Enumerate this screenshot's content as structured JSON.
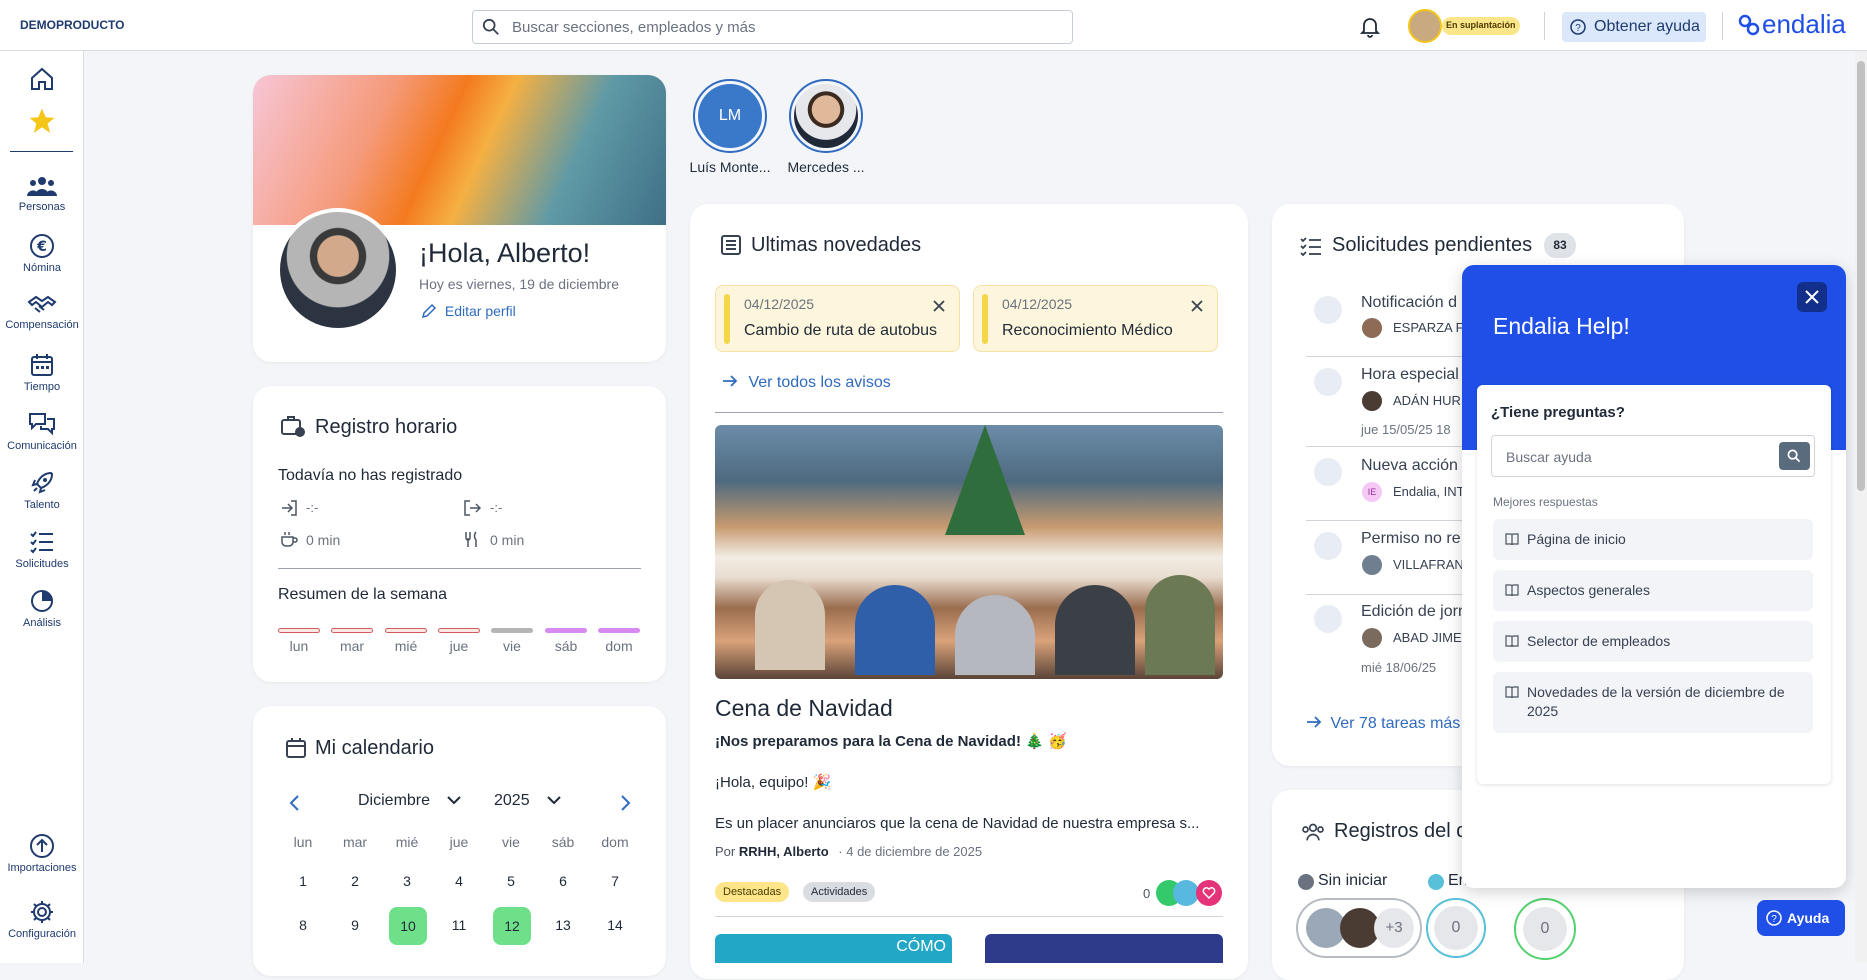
{
  "topbar": {
    "company": "DEMOPRODUCTO",
    "search_placeholder": "Buscar secciones, empleados y más",
    "impersonation": "En suplantación",
    "help_button": "Obtener ayuda",
    "brand": "endalia"
  },
  "sidebar": {
    "items": [
      {
        "label": "Personas",
        "icon": "people-icon"
      },
      {
        "label": "Nómina",
        "icon": "euro-icon"
      },
      {
        "label": "Compensación",
        "icon": "handshake-icon"
      },
      {
        "label": "Tiempo",
        "icon": "calendar-icon"
      },
      {
        "label": "Comunicación",
        "icon": "chat-icon"
      },
      {
        "label": "Talento",
        "icon": "rocket-icon"
      },
      {
        "label": "Solicitudes",
        "icon": "checklist-icon"
      },
      {
        "label": "Análisis",
        "icon": "pie-icon"
      }
    ],
    "bottom": [
      {
        "label": "Importaciones",
        "icon": "upload-icon"
      },
      {
        "label": "Configuración",
        "icon": "gear-icon"
      }
    ]
  },
  "profile": {
    "greeting": "¡Hola, Alberto!",
    "date": "Hoy es viernes, 19 de diciembre",
    "edit": "Editar perfil"
  },
  "time_record": {
    "title": "Registro horario",
    "status": "Todavía no has registrado",
    "in": "-:-",
    "out": "-:-",
    "break": "0 min",
    "meal": "0 min",
    "summary": "Resumen de la semana",
    "days": [
      "lun",
      "mar",
      "mié",
      "jue",
      "vie",
      "sáb",
      "dom"
    ]
  },
  "calendar": {
    "title": "Mi calendario",
    "month": "Diciembre",
    "year": "2025",
    "weekdays": [
      "lun",
      "mar",
      "mié",
      "jue",
      "vie",
      "sáb",
      "dom"
    ],
    "row1": [
      "1",
      "2",
      "3",
      "4",
      "5",
      "6",
      "7"
    ],
    "row2": [
      "8",
      "9",
      "10",
      "11",
      "12",
      "13",
      "14"
    ],
    "highlight": [
      "10",
      "12"
    ]
  },
  "shortcuts": [
    {
      "initials": "LM",
      "name": "Luís Monte..."
    },
    {
      "name": "Mercedes ..."
    }
  ],
  "news": {
    "title": "Ultimas novedades",
    "notices": [
      {
        "date": "04/12/2025",
        "text": "Cambio de ruta de autobus"
      },
      {
        "date": "04/12/2025",
        "text": "Reconocimiento Médico"
      }
    ],
    "see_all": "Ver todos los avisos",
    "post_title": "Cena de Navidad",
    "post_subtitle": "¡Nos preparamos para la Cena de Navidad! 🎄 🥳",
    "post_greeting": "¡Hola, equipo! 🎉",
    "post_body": "Es un placer anunciaros que la cena de Navidad de nuestra empresa s...",
    "post_by_prefix": "Por",
    "post_author": "RRHH, Alberto",
    "post_date": "· 4 de diciembre de 2025",
    "tags": [
      "Destacadas",
      "Actividades"
    ],
    "reactions": "0",
    "next_banner": "CÓMO"
  },
  "requests": {
    "title": "Solicitudes pendientes",
    "count": "83",
    "items": [
      {
        "title": "Notificación d",
        "person": "ESPARZA F",
        "date": ""
      },
      {
        "title": "Hora especial",
        "person": "ADÁN HUR",
        "date": "jue 15/05/25 18"
      },
      {
        "title": "Nueva acción",
        "person": "Endalia, INT",
        "initials": "IE",
        "date": ""
      },
      {
        "title": "Permiso no re",
        "person": "VILLAFRAN",
        "date": ""
      },
      {
        "title": "Edición de jorn",
        "person": "ABAD JIME",
        "date": "mié 18/06/25"
      }
    ],
    "more": "Ver 78 tareas más"
  },
  "records": {
    "title": "Registros del d",
    "not_started": "Sin iniciar",
    "second": "En",
    "plus": "+3",
    "zero1": "0",
    "zero2": "0"
  },
  "help": {
    "title": "Endalia Help!",
    "question": "¿Tiene preguntas?",
    "search_placeholder": "Buscar ayuda",
    "best": "Mejores respuestas",
    "items": [
      "Página de inicio",
      "Aspectos generales",
      "Selector de empleados",
      "Novedades de la versión de diciembre de 2025"
    ],
    "fab": "Ayuda"
  },
  "colors": {
    "accent": "#2f6bbf",
    "help_blue": "#1f4fe6",
    "green": "#6fe08a",
    "yellow": "#fdf6dc"
  }
}
